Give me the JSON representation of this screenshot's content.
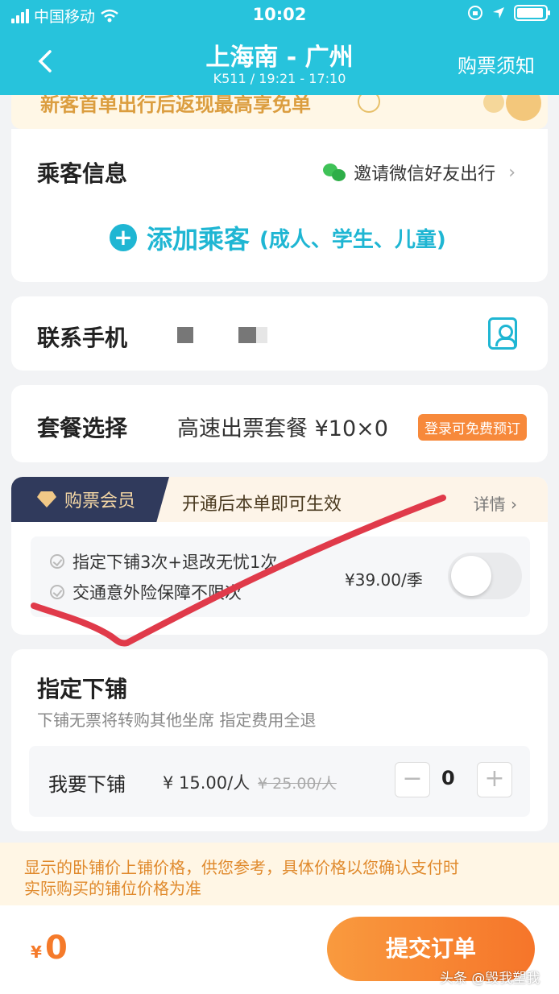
{
  "status_bar": {
    "carrier": "中国移动",
    "time": "10:02"
  },
  "header": {
    "title": "上海南 - 广州",
    "subtitle": "K511 / 19:21 - 17:10",
    "notice_link": "购票须知"
  },
  "promo": {
    "text": "新客首单出行后返现最高享免单"
  },
  "passenger": {
    "label": "乘客信息",
    "invite": "邀请微信好友出行",
    "add_main": "添加乘客",
    "add_sub": "(成人、学生、儿童)"
  },
  "contact": {
    "label": "联系手机"
  },
  "package": {
    "label": "套餐选择",
    "value": "高速出票套餐 ¥10×0",
    "badge": "登录可免费预订"
  },
  "membership": {
    "tag": "购票会员",
    "text": "开通后本单即可生效",
    "detail": "详情",
    "features": [
      "指定下铺3次+退改无忧1次",
      "交通意外险保障不限次"
    ],
    "price": "¥39.00/季",
    "enabled": false
  },
  "berth": {
    "label": "指定下铺",
    "subtitle": "下铺无票将转购其他坐席 指定费用全退",
    "row_label": "我要下铺",
    "price": "¥ 15.00/人",
    "original_price": "¥ 25.00/人",
    "quantity": "0",
    "minus": "−",
    "plus": "+"
  },
  "disclaimer": {
    "line1": "显示的卧铺价上铺价格，供您参考，具体价格以您确认支付时",
    "line2": "实际购买的铺位价格为准"
  },
  "bottom": {
    "currency": "¥",
    "total": "0",
    "submit": "提交订单",
    "watermark": "头条 @毁我塑我"
  },
  "colors": {
    "header": "#27c3dc",
    "accent": "#1fb6d3",
    "orange": "#f6752a",
    "annotation": "#e03a4a"
  }
}
